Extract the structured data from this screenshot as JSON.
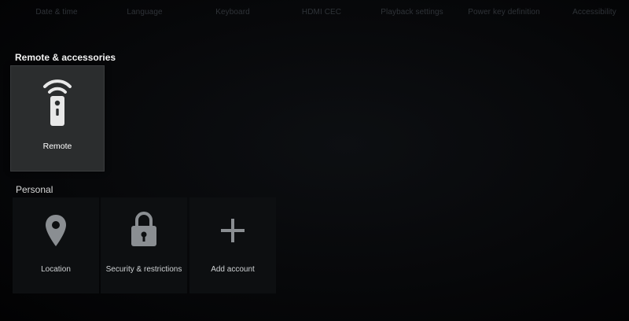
{
  "top_tabs": [
    {
      "label": "Date & time"
    },
    {
      "label": "Language"
    },
    {
      "label": "Keyboard"
    },
    {
      "label": "HDMI CEC"
    },
    {
      "label": "Playback settings"
    },
    {
      "label": "Power key definition"
    },
    {
      "label": "Accessibility"
    }
  ],
  "sections": {
    "remote": {
      "title": "Remote & accessories",
      "tiles": [
        {
          "label": "Remote",
          "icon": "remote-wifi-icon"
        }
      ]
    },
    "personal": {
      "title": "Personal",
      "tiles": [
        {
          "label": "Location",
          "icon": "location-pin-icon"
        },
        {
          "label": "Security & restrictions",
          "icon": "lock-icon"
        },
        {
          "label": "Add account",
          "icon": "plus-icon"
        }
      ]
    }
  },
  "colors": {
    "background": "#000000",
    "focused_tile": "#2b2d2e",
    "tile": "#0d0f11",
    "icon_light": "#e8e8e8",
    "icon_muted": "#8a8e92"
  }
}
